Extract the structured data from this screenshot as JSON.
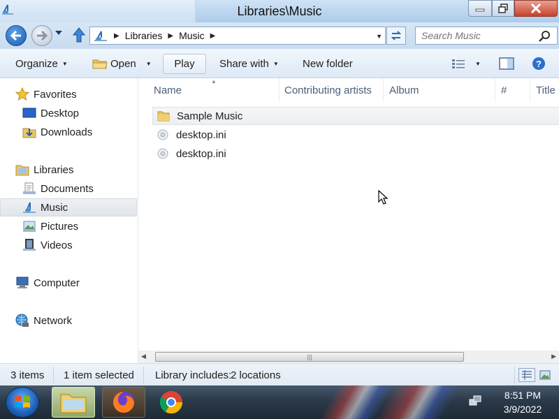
{
  "window": {
    "title": "Libraries\\Music"
  },
  "address": {
    "crumbs": [
      "Libraries",
      "Music"
    ],
    "search_placeholder": "Search Music"
  },
  "toolbar": {
    "organize": "Organize",
    "open": "Open",
    "play": "Play",
    "share_with": "Share with",
    "new_folder": "New folder"
  },
  "nav": {
    "favorites": "Favorites",
    "desktop": "Desktop",
    "downloads": "Downloads",
    "libraries": "Libraries",
    "documents": "Documents",
    "music": "Music",
    "pictures": "Pictures",
    "videos": "Videos",
    "computer": "Computer",
    "network": "Network"
  },
  "columns": {
    "name": "Name",
    "contributing_artists": "Contributing artists",
    "album": "Album",
    "number": "#",
    "title": "Title"
  },
  "files": [
    {
      "name": "Sample Music",
      "icon": "folder-icon"
    },
    {
      "name": "desktop.ini",
      "icon": "settings-file-icon"
    },
    {
      "name": "desktop.ini",
      "icon": "settings-file-icon"
    }
  ],
  "status": {
    "items": "3 items",
    "selected": "1 item selected",
    "library": "Library includes:",
    "locations": "2 locations"
  },
  "clock": {
    "time": "8:51 PM",
    "date": "3/9/2022"
  },
  "colors": {
    "accent": "#1a5bb3",
    "selection": "#e1e5ea",
    "taskbar": "#2b3a49"
  }
}
